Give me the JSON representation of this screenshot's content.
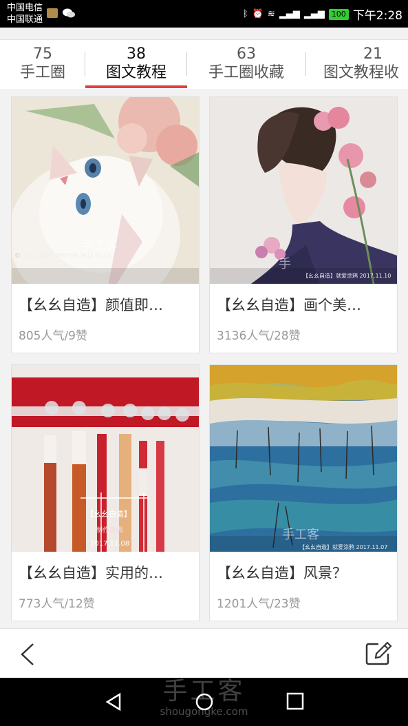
{
  "status_bar": {
    "carrier1": "中国电信",
    "carrier2": "中国联通",
    "battery": "100",
    "time": "下午2:28"
  },
  "tabs": [
    {
      "count": "75",
      "label": "手工圈"
    },
    {
      "count": "38",
      "label": "图文教程"
    },
    {
      "count": "63",
      "label": "手工圈收藏"
    },
    {
      "count": "21",
      "label": "图文教程收"
    }
  ],
  "cards": [
    {
      "title": "【幺幺自造】颜值即…",
      "meta": "805人气/9赞",
      "caption": "【幺幺自造】就爱涂鸦 2017.11.15",
      "watermark": "手工客"
    },
    {
      "title": "【幺幺自造】画个美…",
      "meta": "3136人气/28赞",
      "caption": "【幺幺自造】就爱涂鸦 2017.11.10",
      "watermark": "手"
    },
    {
      "title": "【幺幺自造】实用的…",
      "meta": "773人气/12赞",
      "caption_line1": "【幺幺自造】",
      "caption_line2": "制作就做",
      "caption_line3": "2017.11.08"
    },
    {
      "title": "【幺幺自造】风景？",
      "meta": "1201人气/23赞",
      "caption": "【幺幺自造】就爱涂鸦 2017.11.07",
      "watermark": "手工客"
    }
  ],
  "footer_watermark": {
    "main": "手工客",
    "sub": "shougongke.com"
  }
}
